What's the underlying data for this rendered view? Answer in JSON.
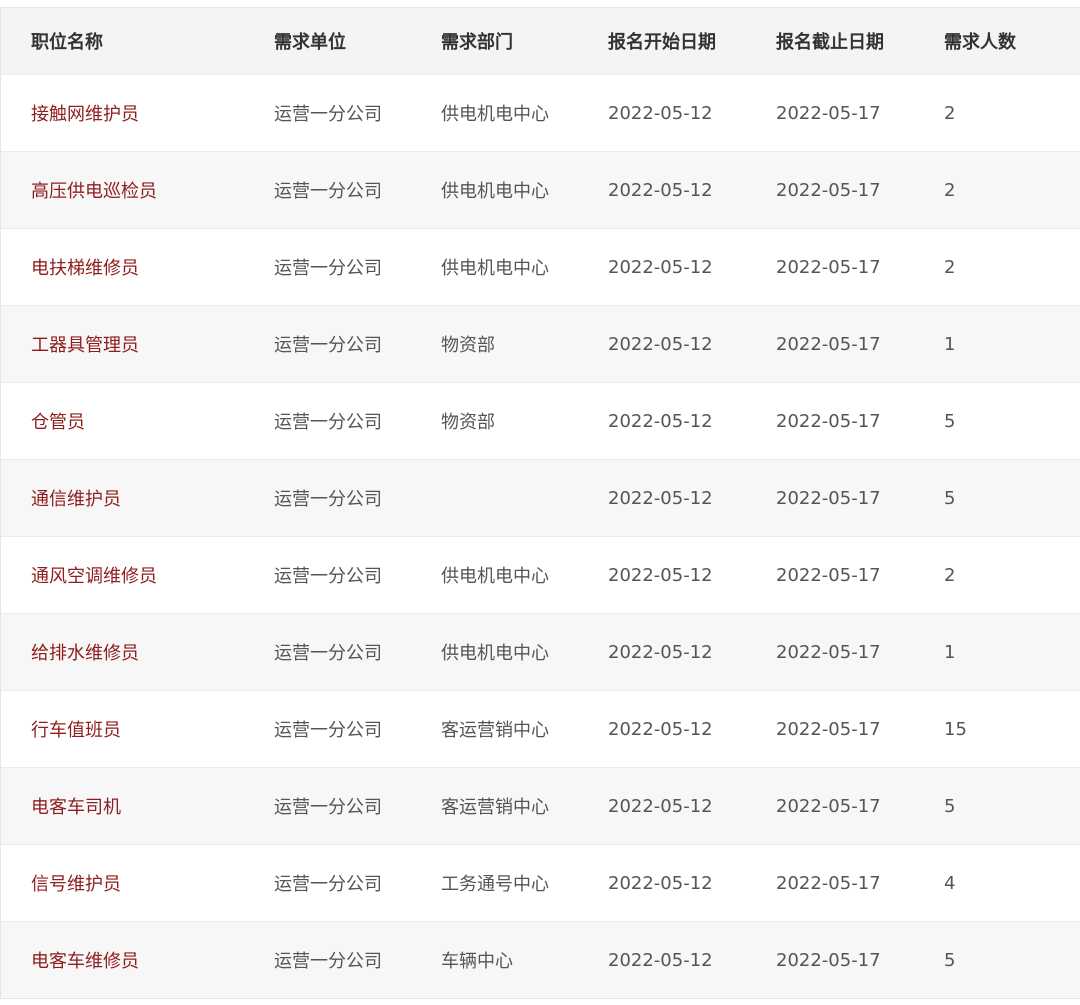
{
  "table": {
    "headers": [
      "职位名称",
      "需求单位",
      "需求部门",
      "报名开始日期",
      "报名截止日期",
      "需求人数"
    ],
    "rows": [
      [
        "接触网维护员",
        "运营一分公司",
        "供电机电中心",
        "2022-05-12",
        "2022-05-17",
        "2"
      ],
      [
        "高压供电巡检员",
        "运营一分公司",
        "供电机电中心",
        "2022-05-12",
        "2022-05-17",
        "2"
      ],
      [
        "电扶梯维修员",
        "运营一分公司",
        "供电机电中心",
        "2022-05-12",
        "2022-05-17",
        "2"
      ],
      [
        "工器具管理员",
        "运营一分公司",
        "物资部",
        "2022-05-12",
        "2022-05-17",
        "1"
      ],
      [
        "仓管员",
        "运营一分公司",
        "物资部",
        "2022-05-12",
        "2022-05-17",
        "5"
      ],
      [
        "通信维护员",
        "运营一分公司",
        "",
        "2022-05-12",
        "2022-05-17",
        "5"
      ],
      [
        "通风空调维修员",
        "运营一分公司",
        "供电机电中心",
        "2022-05-12",
        "2022-05-17",
        "2"
      ],
      [
        "给排水维修员",
        "运营一分公司",
        "供电机电中心",
        "2022-05-12",
        "2022-05-17",
        "1"
      ],
      [
        "行车值班员",
        "运营一分公司",
        "客运营销中心",
        "2022-05-12",
        "2022-05-17",
        "15"
      ],
      [
        "电客车司机",
        "运营一分公司",
        "客运营销中心",
        "2022-05-12",
        "2022-05-17",
        "5"
      ],
      [
        "信号维护员",
        "运营一分公司",
        "工务通号中心",
        "2022-05-12",
        "2022-05-17",
        "4"
      ],
      [
        "电客车维修员",
        "运营一分公司",
        "车辆中心",
        "2022-05-12",
        "2022-05-17",
        "5"
      ]
    ]
  },
  "colors": {
    "position_text": "#8e1d1d",
    "body_text": "#555555",
    "header_bg": "#f4f4f4",
    "stripe_bg": "#f7f7f7"
  }
}
